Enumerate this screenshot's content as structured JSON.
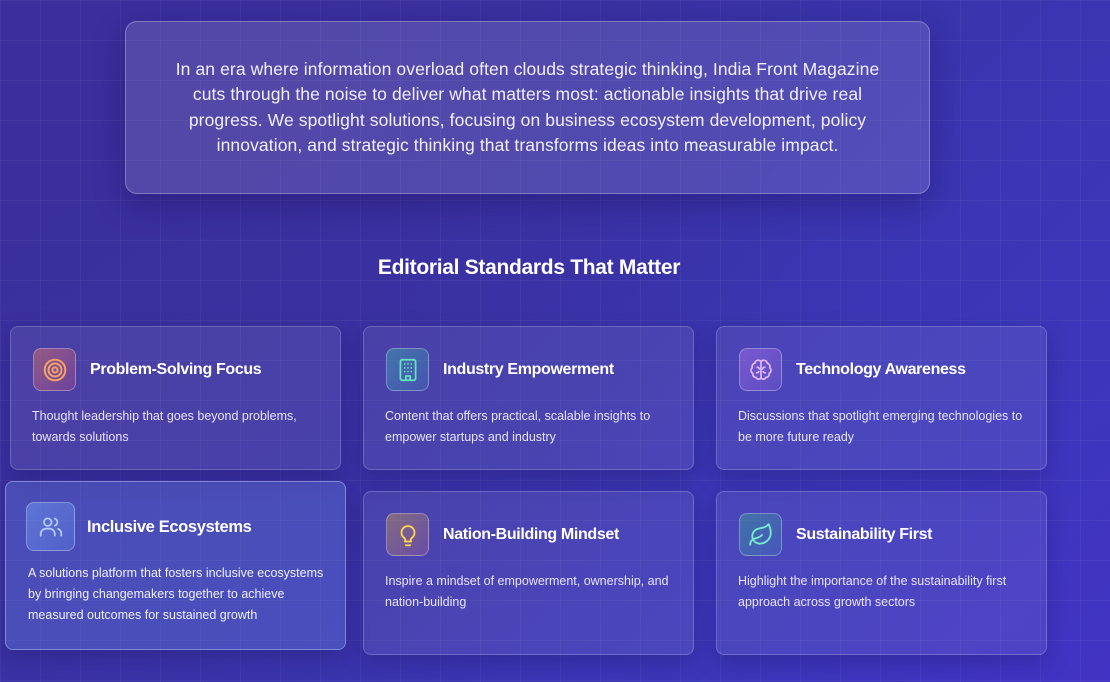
{
  "intro": {
    "text": "In an era where information overload often clouds strategic thinking, India Front Magazine cuts through the noise to deliver what matters most: actionable insights that drive real progress. We spotlight solutions, focusing on business ecosystem development, policy innovation, and strategic thinking that transforms ideas into measurable impact."
  },
  "section": {
    "title": "Editorial Standards That Matter"
  },
  "cards": [
    {
      "title": "Problem-Solving Focus",
      "description": "Thought leadership that goes beyond problems, towards solutions",
      "icon": "target-icon",
      "color": "#f59e5b"
    },
    {
      "title": "Industry Empowerment",
      "description": "Content that offers practical, scalable insights to empower startups and industry",
      "icon": "building-icon",
      "color": "#5fe0b8"
    },
    {
      "title": "Technology Awareness",
      "description": "Discussions that spotlight emerging technologies to be more future ready",
      "icon": "brain-icon",
      "color": "#d6a6ff"
    },
    {
      "title": "Inclusive Ecosystems",
      "description": "A solutions platform that fosters inclusive ecosystems by bringing changemakers together to achieve measured outcomes for sustained growth",
      "icon": "users-icon",
      "color": "#a9c8ff"
    },
    {
      "title": "Nation-Building Mindset",
      "description": "Inspire a mindset of empowerment, ownership, and nation-building",
      "icon": "lightbulb-icon",
      "color": "#ffd34d"
    },
    {
      "title": "Sustainability First",
      "description": "Highlight the importance of the sustainability first approach across growth sectors",
      "icon": "leaf-icon",
      "color": "#6ee7c4"
    }
  ]
}
